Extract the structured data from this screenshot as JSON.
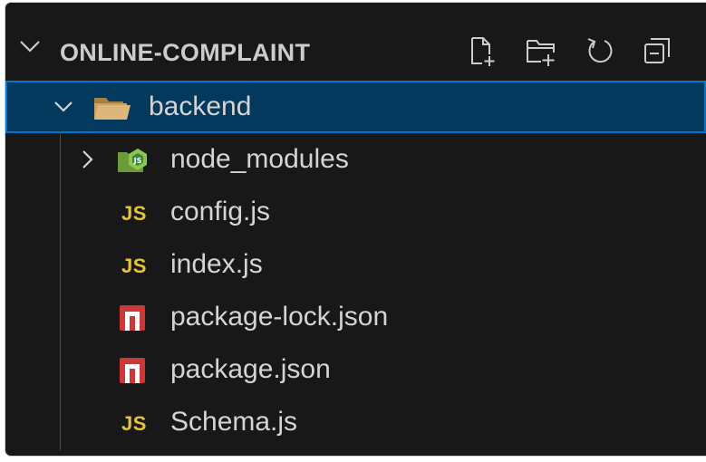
{
  "explorer": {
    "section_title": "ONLINE-COMPLAINT",
    "actions": [
      {
        "name": "new-file-icon"
      },
      {
        "name": "new-folder-icon"
      },
      {
        "name": "refresh-icon"
      },
      {
        "name": "collapse-all-icon"
      }
    ]
  },
  "tree": {
    "folder": {
      "label": "backend",
      "expanded": true,
      "icon": "folder-open-icon"
    },
    "items": [
      {
        "label": "node_modules",
        "type": "folder",
        "icon": "nodejs-folder-icon",
        "expanded": false
      },
      {
        "label": "config.js",
        "type": "file",
        "icon": "js-file-icon",
        "badge": "JS"
      },
      {
        "label": "index.js",
        "type": "file",
        "icon": "js-file-icon",
        "badge": "JS"
      },
      {
        "label": "package-lock.json",
        "type": "file",
        "icon": "npm-icon"
      },
      {
        "label": "package.json",
        "type": "file",
        "icon": "npm-icon"
      },
      {
        "label": "Schema.js",
        "type": "file",
        "icon": "js-file-icon",
        "badge": "JS"
      }
    ]
  },
  "colors": {
    "background": "#181818",
    "selection": "#04395e",
    "selection_border": "#0078d4",
    "js_yellow": "#e5c33a",
    "npm_red": "#cb3837",
    "folder": "#c09553",
    "node_green": "#8cc84b"
  }
}
